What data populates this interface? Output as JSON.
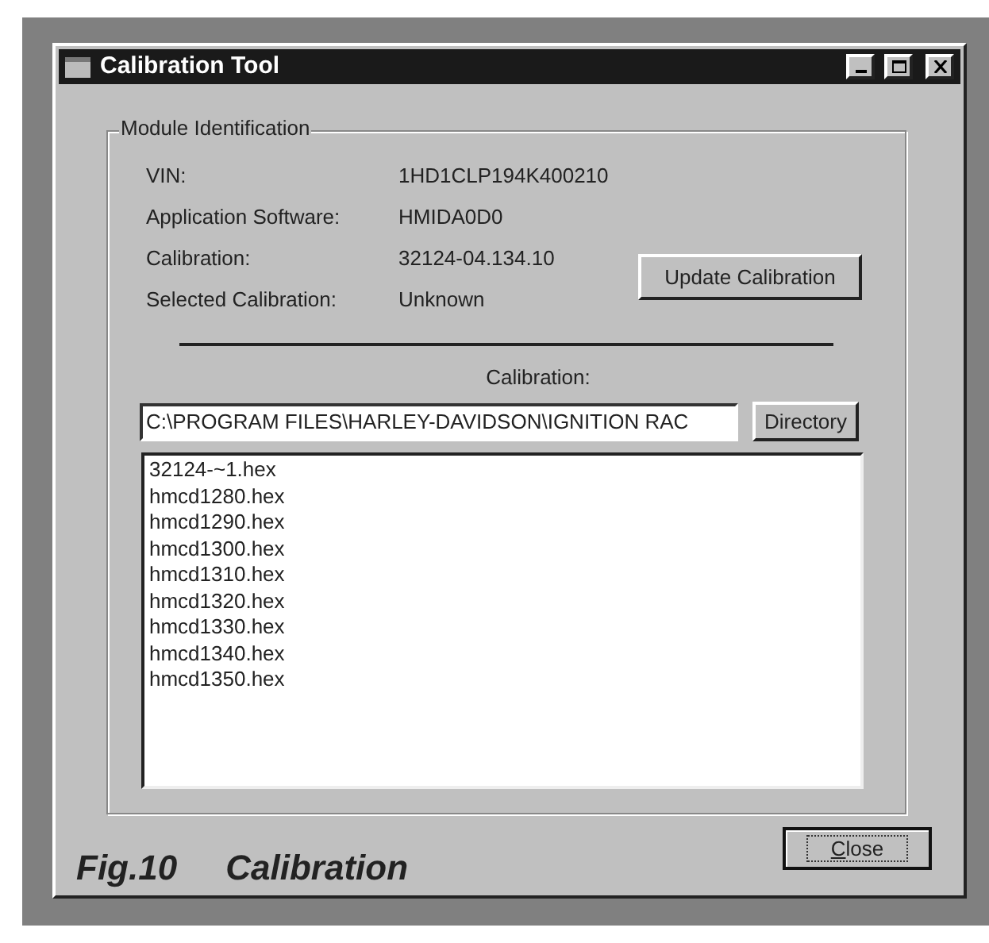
{
  "window": {
    "title": "Calibration Tool"
  },
  "module_identification": {
    "title": "Module Identification",
    "fields": [
      {
        "label": "VIN:",
        "value": "1HD1CLP194K400210"
      },
      {
        "label": "Application Software:",
        "value": "HMIDA0D0"
      },
      {
        "label": "Calibration:",
        "value": "32124-04.134.10"
      },
      {
        "label": "Selected Calibration:",
        "value": "Unknown"
      }
    ],
    "update_button": "Update Calibration",
    "calibration_label": "Calibration:",
    "path": "C:\\PROGRAM FILES\\HARLEY-DAVIDSON\\IGNITION RAC",
    "directory_button": "Directory",
    "files": [
      "32124-~1.hex",
      "hmcd1280.hex",
      "hmcd1290.hex",
      "hmcd1300.hex",
      "hmcd1310.hex",
      "hmcd1320.hex",
      "hmcd1330.hex",
      "hmcd1340.hex",
      "hmcd1350.hex"
    ]
  },
  "caption": "Fig.10     Calibration",
  "close_button": {
    "label": "Close",
    "access_key_underlined": true
  }
}
